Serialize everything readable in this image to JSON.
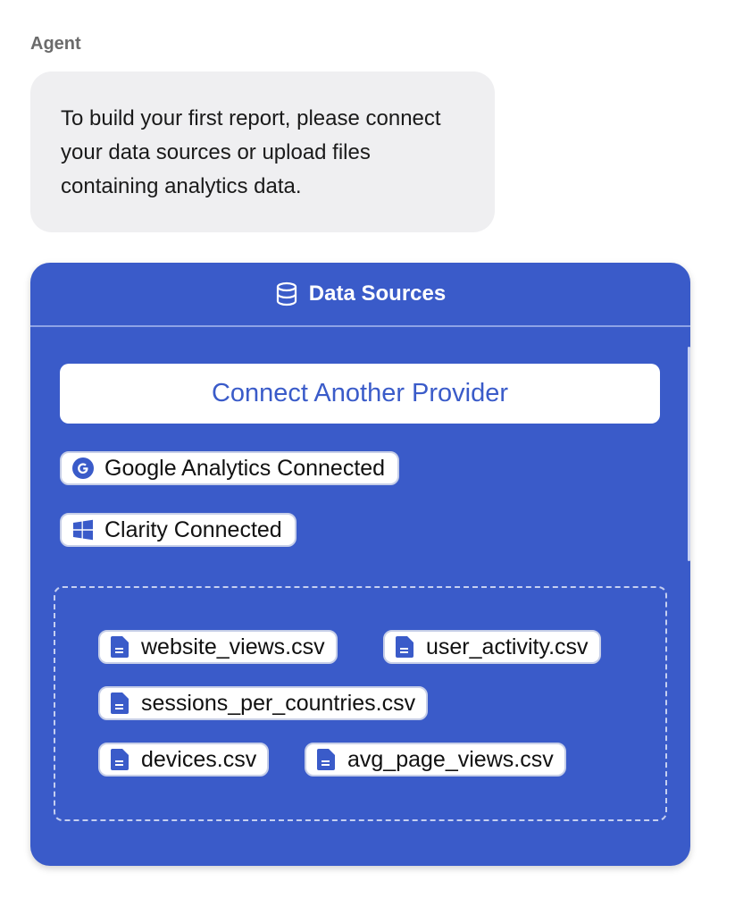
{
  "message": {
    "sender": "Agent",
    "text": "To build your first report, please connect your data sources or upload files containing analytics data."
  },
  "data_sources": {
    "title": "Data Sources",
    "title_icon": "database-icon",
    "connect_button": "Connect Another Provider",
    "providers": [
      {
        "label": "Google Analytics Connected",
        "icon": "google-icon"
      },
      {
        "label": "Clarity Connected",
        "icon": "windows-icon"
      }
    ],
    "files": [
      {
        "name": "website_views.csv",
        "icon": "file-icon"
      },
      {
        "name": "user_activity.csv",
        "icon": "file-icon"
      },
      {
        "name": "sessions_per_countries.csv",
        "icon": "file-icon"
      },
      {
        "name": "devices.csv",
        "icon": "file-icon"
      },
      {
        "name": "avg_page_views.csv",
        "icon": "file-icon"
      }
    ]
  },
  "colors": {
    "panel": "#3a5bc9",
    "bubble": "#efeff1",
    "file_icon": "#3a5bc9"
  }
}
